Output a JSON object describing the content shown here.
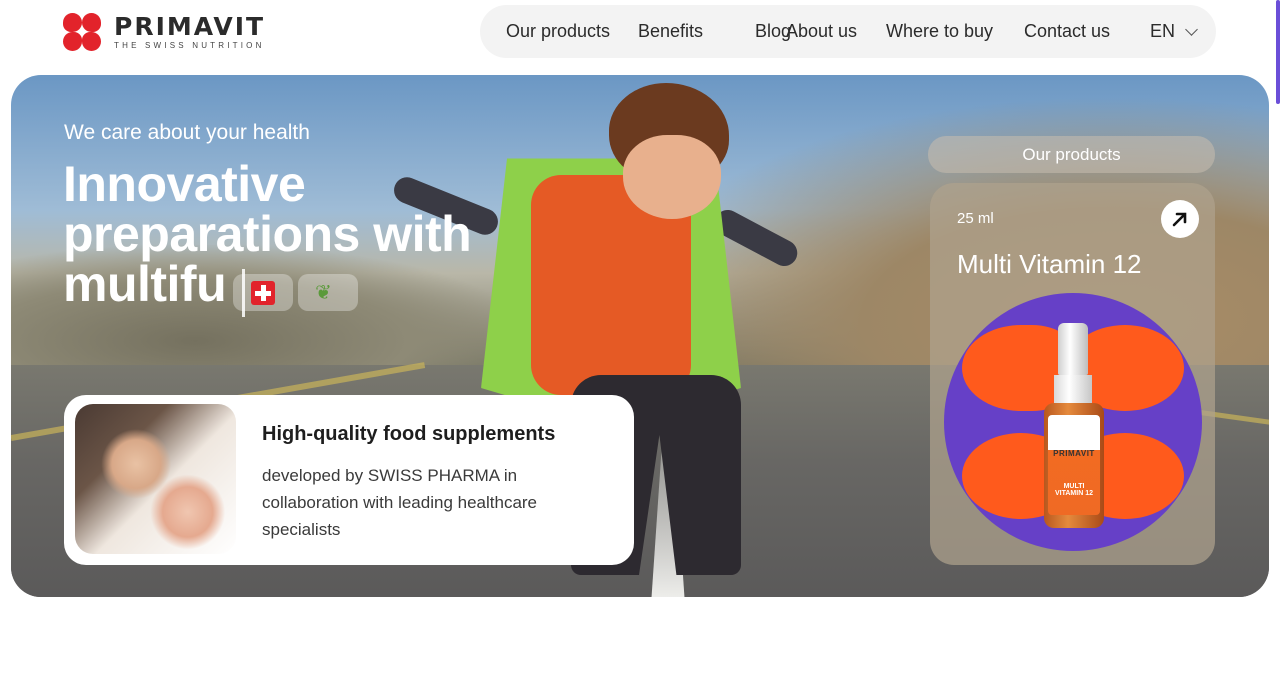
{
  "brand": {
    "name": "PRIMAVIT",
    "tagline": "THE SWISS NUTRITION",
    "color": "#e2232b"
  },
  "nav": {
    "items": [
      "Our products",
      "Benefits",
      "Blog",
      "About us",
      "Where to buy",
      "Contact us"
    ],
    "language": "EN"
  },
  "hero": {
    "subtitle": "We care about your health",
    "title": "Innovative preparations with multifu",
    "chips": [
      "swiss-flag-icon",
      "leaf-icon"
    ],
    "info_card": {
      "title": "High-quality food supplements",
      "text": "developed by SWISS PHARMA in collaboration with leading healthcare specialists"
    },
    "products": {
      "pill_label": "Our products",
      "card": {
        "volume": "25 ml",
        "name": "Multi Vitamin 12",
        "accent_circle": "#6640c7",
        "accent_petals": "#ff5a1c",
        "bottle_brand": "PRIMAVIT",
        "bottle_line": "MULTI VITAMIN 12"
      }
    }
  }
}
